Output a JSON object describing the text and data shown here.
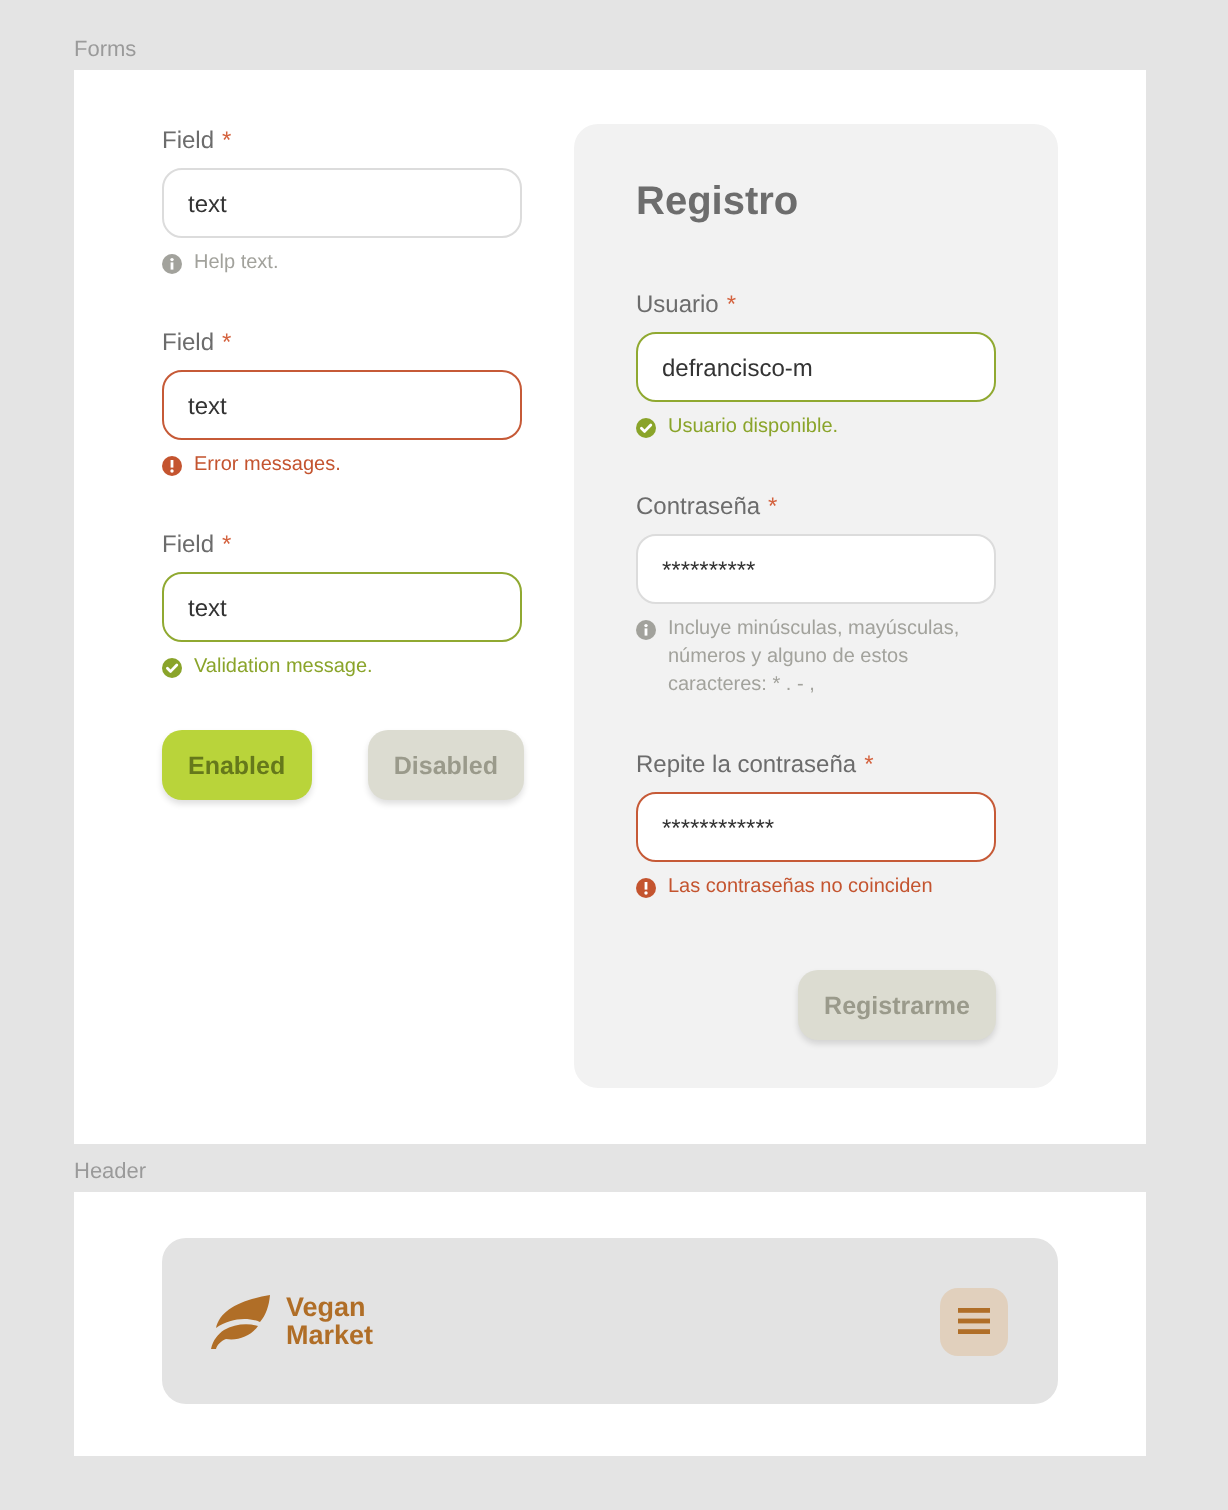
{
  "forms": {
    "label": "Forms",
    "fields": [
      {
        "label": "Field",
        "required_mark": "*",
        "value": "text",
        "kind": "help",
        "message": "Help text."
      },
      {
        "label": "Field",
        "required_mark": "*",
        "value": "text",
        "kind": "error",
        "message": "Error messages."
      },
      {
        "label": "Field",
        "required_mark": "*",
        "value": "text",
        "kind": "success",
        "message": "Validation message."
      }
    ],
    "buttons": [
      {
        "label": "Enabled",
        "disabled": false
      },
      {
        "label": "Disabled",
        "disabled": true
      }
    ],
    "register_card": {
      "title": "Registro",
      "fields": [
        {
          "label": "Usuario",
          "required_mark": "*",
          "value": "defrancisco-m",
          "kind": "success",
          "message": "Usuario disponible."
        },
        {
          "label": "Contraseña",
          "required_mark": "*",
          "value": "**********",
          "kind": "help",
          "message": "Incluye minúsculas, mayúsculas, números y alguno de estos caracteres: * . - ,"
        },
        {
          "label": "Repite la contraseña",
          "required_mark": "*",
          "value": "************",
          "kind": "error",
          "message": "Las contraseñas no coinciden"
        }
      ],
      "submit_button": {
        "label": "Registrarme",
        "disabled": true
      }
    }
  },
  "header": {
    "label": "Header",
    "brand_name": "Vegan Market"
  }
}
